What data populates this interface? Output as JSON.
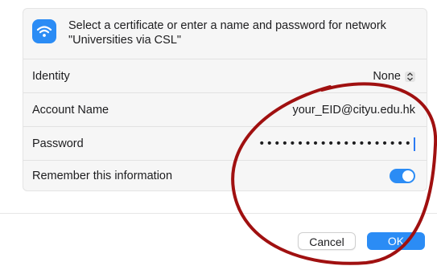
{
  "dialog": {
    "message": "Select a certificate or enter a name and password for network \"Universities via CSL\""
  },
  "fields": {
    "identity": {
      "label": "Identity",
      "value": "None"
    },
    "account_name": {
      "label": "Account Name",
      "value": "your_EID@cityu.edu.hk"
    },
    "password": {
      "label": "Password",
      "value": "••••••••••••••••••••"
    },
    "remember": {
      "label": "Remember this information",
      "enabled": true
    }
  },
  "buttons": {
    "cancel": "Cancel",
    "ok": "OK"
  },
  "colors": {
    "accent": "#2b8cf5",
    "annotation": "#a01010"
  },
  "icons": {
    "network": "wifi-icon",
    "popup": "up-down-chevron-icon"
  }
}
